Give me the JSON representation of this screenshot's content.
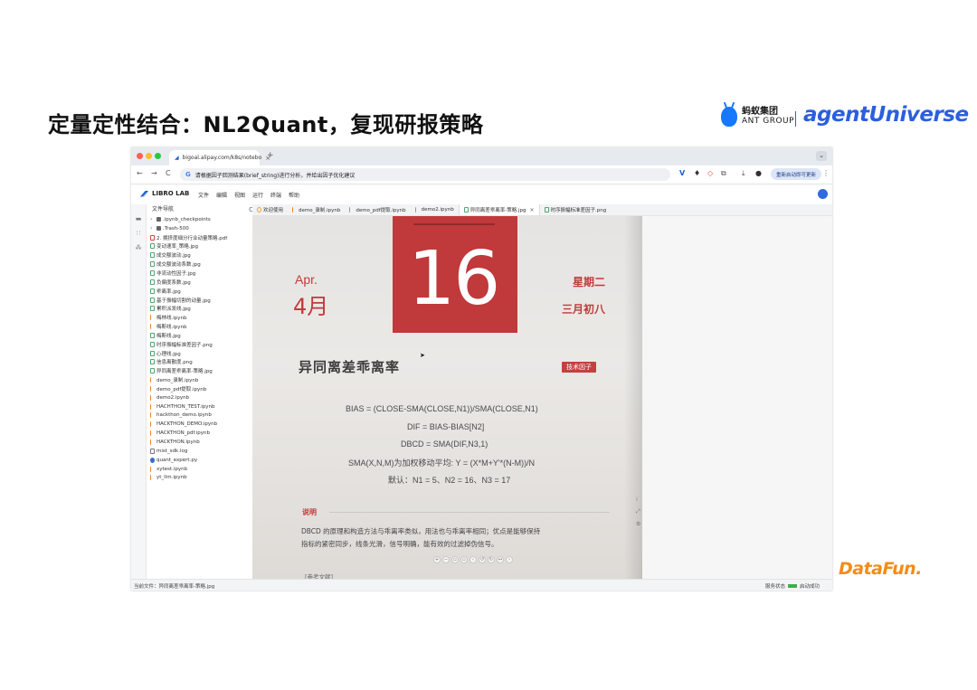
{
  "slide": {
    "title": "定量定性结合：NL2Quant，复现研报策略",
    "logos": {
      "ant_cn": "蚂蚁集团",
      "ant_en": "ANT GROUP",
      "agent": "agentUniverse",
      "datafun": "DataFun."
    }
  },
  "browser": {
    "tab_title": "bigoal.alipay.com/k8s/notebo",
    "tab_close": "×",
    "new_tab": "+",
    "nav": {
      "back": "←",
      "forward": "→",
      "reload": "C"
    },
    "url": "请根据因子回测结果(brief_string)进行分析，并给出因子优化建议",
    "update_button": "重新启动即可更新",
    "menu": "⋮"
  },
  "app": {
    "logo": "LIBRO LAB",
    "menu": [
      "文件",
      "编辑",
      "视图",
      "运行",
      "终端",
      "帮助"
    ]
  },
  "explorer": {
    "title": "文件导航",
    "items": [
      {
        "name": ".ipynb_checkpoints",
        "type": "folder"
      },
      {
        "name": ".Trash-500",
        "type": "folder"
      },
      {
        "name": "2. 拥挤度细分行业动量策略.pdf",
        "type": "pdf"
      },
      {
        "name": "变动速率_策略.jpg",
        "type": "img"
      },
      {
        "name": "成交额波动.jpg",
        "type": "img"
      },
      {
        "name": "成交额波动系数.jpg",
        "type": "img"
      },
      {
        "name": "非流动性因子.jpg",
        "type": "img"
      },
      {
        "name": "负偏度系数.jpg",
        "type": "img"
      },
      {
        "name": "乖离率.jpg",
        "type": "img"
      },
      {
        "name": "基于振幅切割的动量.jpg",
        "type": "img"
      },
      {
        "name": "累积派发线.jpg",
        "type": "img"
      },
      {
        "name": "梅林线.ipynb",
        "type": "nb"
      },
      {
        "name": "梅斯线.ipynb",
        "type": "nb"
      },
      {
        "name": "梅斯线.jpg",
        "type": "img"
      },
      {
        "name": "时序振幅标准差因子.png",
        "type": "img"
      },
      {
        "name": "心理线.jpg",
        "type": "img"
      },
      {
        "name": "信息离散度.png",
        "type": "img"
      },
      {
        "name": "异同离差乖离率-策略.jpg",
        "type": "img"
      },
      {
        "name": "demo_录制.ipynb",
        "type": "nb"
      },
      {
        "name": "demo_pdf提取.ipynb",
        "type": "nb"
      },
      {
        "name": "demo2.ipynb",
        "type": "nb"
      },
      {
        "name": "HACHTHON_TEST.ipynb",
        "type": "nb"
      },
      {
        "name": "hackthon_demo.ipynb",
        "type": "nb"
      },
      {
        "name": "HACKTHON_DEMO.ipynb",
        "type": "nb"
      },
      {
        "name": "HACKTHON_pdf.ipynb",
        "type": "nb"
      },
      {
        "name": "HACKTHON.ipynb",
        "type": "nb"
      },
      {
        "name": "mist_sdk.log",
        "type": "log"
      },
      {
        "name": "quant_expert.py",
        "type": "py"
      },
      {
        "name": "xytest.ipynb",
        "type": "nb"
      },
      {
        "name": "yt_llm.ipynb",
        "type": "nb"
      }
    ]
  },
  "editor_tabs": [
    {
      "label": "欢迎使用",
      "type": "welcome",
      "active": false
    },
    {
      "label": "demo_录制.ipynb",
      "type": "nb",
      "active": false
    },
    {
      "label": "demo_pdf提取.ipynb",
      "type": "nb",
      "active": false
    },
    {
      "label": "demo2.ipynb",
      "type": "nb",
      "active": false
    },
    {
      "label": "异同离差乖离率-策略.jpg",
      "type": "img",
      "active": true
    },
    {
      "label": "时序振幅标准差因子.png",
      "type": "img",
      "active": false
    }
  ],
  "image": {
    "month_en": "Apr.",
    "month_cn": "4月",
    "day": "16",
    "weekday": "星期二",
    "lunar": "三月初八",
    "title": "异同离差乖离率",
    "tag": "技术因子",
    "formulas": [
      "BIAS = (CLOSE-SMA(CLOSE,N1))/SMA(CLOSE,N1)",
      "DIF = BIAS-BIAS[N2]",
      "DBCD = SMA(DIF,N3,1)",
      "SMA(X,N,M)为加权移动平均: Y = (X*M+Y'*(N-M))/N",
      "默认：N1 = 5、N2 = 16、N3 = 17"
    ],
    "note_title": "说明",
    "note_lines": [
      "DBCD 的原理和构造方法与乖离率类似，用法也与乖离率相同；优点是能够保持",
      "指标的紧密同步，线条光滑，信号明确，能有效的过滤掉伪信号。"
    ],
    "reference": "[参考文献]"
  },
  "statusbar": {
    "current_file": "当前文件：异同离差乖离率-策略.jpg",
    "server_label": "服务状态",
    "server_state": "启动成功"
  }
}
